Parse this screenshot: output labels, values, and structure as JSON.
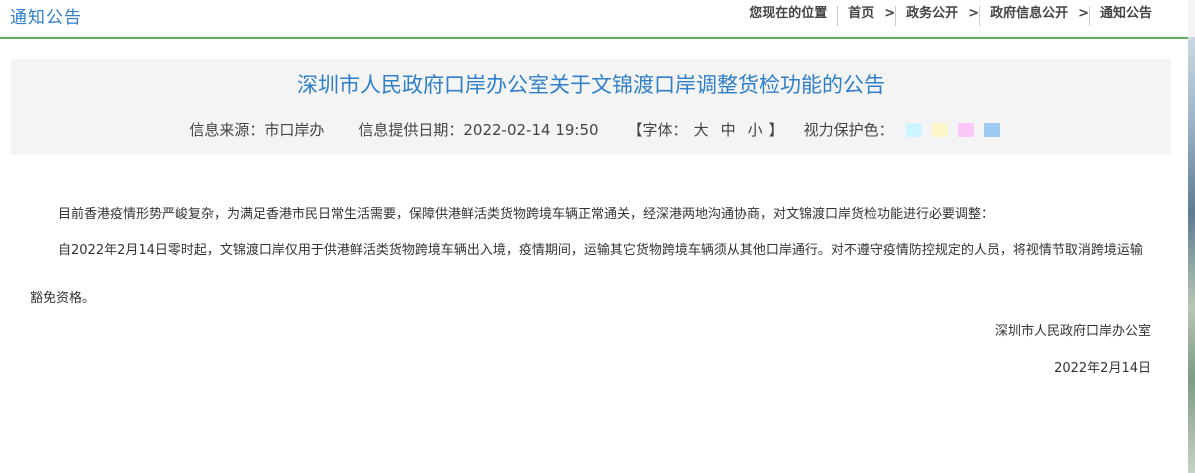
{
  "header": {
    "section_title": "通知公告",
    "breadcrumb": {
      "location_label": "您现在的位置",
      "separator": ">",
      "items": [
        {
          "label": "首页"
        },
        {
          "label": "政务公开"
        },
        {
          "label": "政府信息公开"
        },
        {
          "label": "通知公告"
        }
      ]
    }
  },
  "article": {
    "title": "深圳市人民政府口岸办公室关于文锦渡口岸调整货检功能的公告",
    "meta": {
      "source": "信息来源：市口岸办",
      "date": "信息提供日期：2022-02-14 19:50",
      "font_open": "【字体：",
      "font_large": "大",
      "font_medium": "中",
      "font_small": "小",
      "font_close": "】",
      "eye_care_label": "视力保护色："
    },
    "eye_care_colors": [
      "#ccf5ff",
      "#fbf6c9",
      "#fcc7f9",
      "#9fcbf2"
    ],
    "paragraphs": [
      "目前香港疫情形势严峻复杂，为满足香港市民日常生活需要，保障供港鲜活类货物跨境车辆正常通关，经深港两地沟通协商，对文锦渡口岸货检功能进行必要调整：",
      "自2022年2月14日零时起，文锦渡口岸仅用于供港鲜活类货物跨境车辆出入境，疫情期间，运输其它货物跨境车辆须从其他口岸通行。对不遵守疫情防控规定的人员，将视情节取消跨境运输豁免资格。"
    ],
    "signature": {
      "org": "深圳市人民政府口岸办公室",
      "date": "2022年2月14日"
    }
  }
}
